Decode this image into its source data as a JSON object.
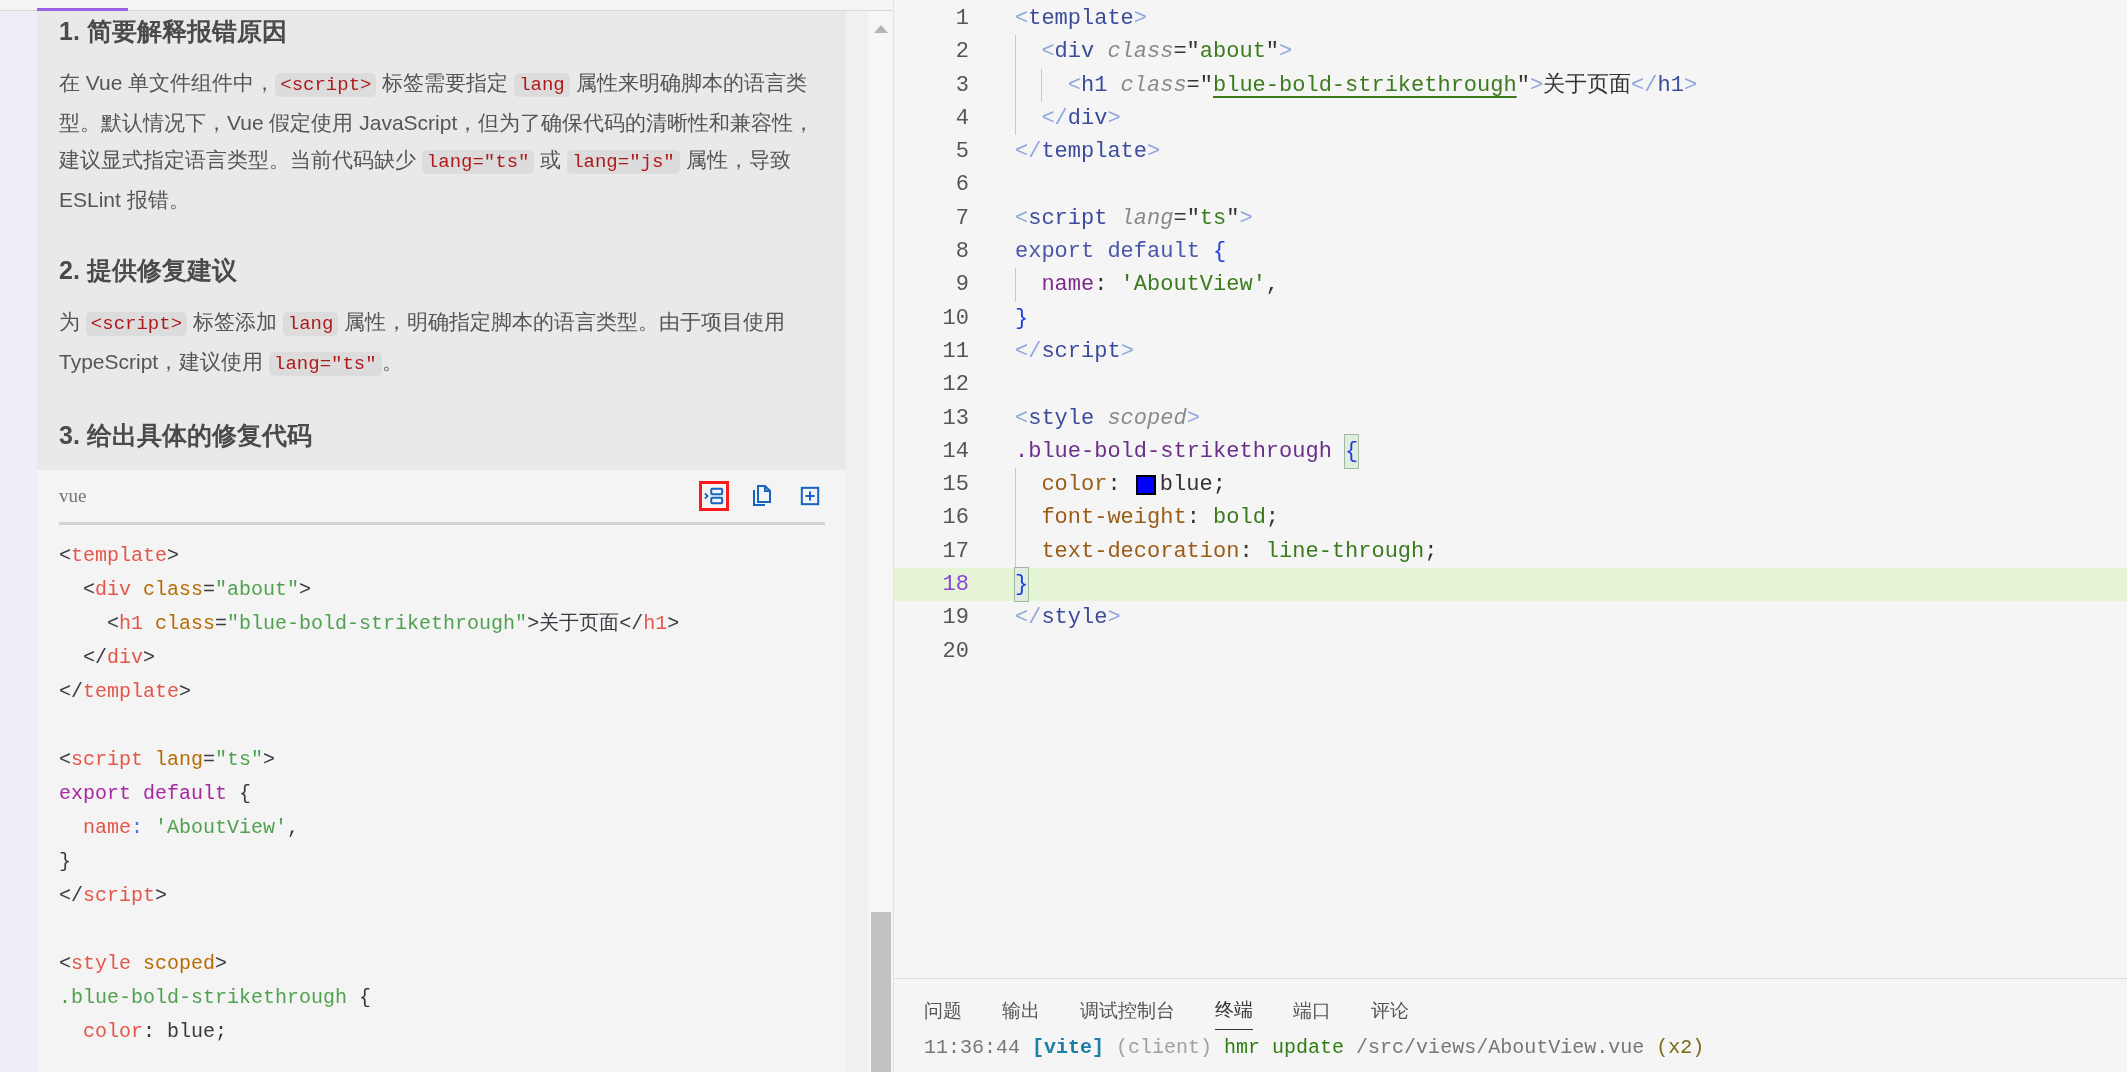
{
  "answer": {
    "sections": [
      {
        "heading": "1. 简要解释报错原因",
        "paragraph": [
          {
            "text": "在 Vue 单文件组件中，",
            "code": false
          },
          {
            "text": "<script>",
            "code": true
          },
          {
            "text": " 标签需要指定 ",
            "code": false
          },
          {
            "text": "lang",
            "code": true
          },
          {
            "text": " 属性来明确脚本的语言类型。默认情况下，Vue 假定使用 JavaScript，但为了确保代码的清晰性和兼容性，建议显式指定语言类型。当前代码缺少 ",
            "code": false
          },
          {
            "text": "lang=\"ts\"",
            "code": true
          },
          {
            "text": " 或 ",
            "code": false
          },
          {
            "text": "lang=\"js\"",
            "code": true
          },
          {
            "text": " 属性，导致 ESLint 报错。",
            "code": false
          }
        ]
      },
      {
        "heading": "2. 提供修复建议",
        "paragraph": [
          {
            "text": "为 ",
            "code": false
          },
          {
            "text": "<script>",
            "code": true
          },
          {
            "text": " 标签添加 ",
            "code": false
          },
          {
            "text": "lang",
            "code": true
          },
          {
            "text": " 属性，明确指定脚本的语言类型。由于项目使用 TypeScript，建议使用 ",
            "code": false
          },
          {
            "text": "lang=\"ts\"",
            "code": true
          },
          {
            "text": "。",
            "code": false
          }
        ]
      },
      {
        "heading": "3. 给出具体的修复代码"
      }
    ],
    "code_block": {
      "language": "vue",
      "toolbar": [
        {
          "kind": "insert",
          "highlighted": true
        },
        {
          "kind": "copy",
          "highlighted": false
        },
        {
          "kind": "expand",
          "highlighted": false
        }
      ],
      "lines": [
        {
          "kind": "code",
          "tokens": [
            {
              "kind": "punct",
              "text": "<"
            },
            {
              "kind": "tag",
              "text": "template"
            },
            {
              "kind": "punct",
              "text": ">"
            }
          ]
        },
        {
          "kind": "code",
          "tokens": [
            {
              "kind": "punct",
              "text": "  <"
            },
            {
              "kind": "tag",
              "text": "div"
            },
            {
              "kind": "attr",
              "text": " class"
            },
            {
              "kind": "punct",
              "text": "="
            },
            {
              "kind": "string",
              "text": "\"about\""
            },
            {
              "kind": "punct",
              "text": ">"
            }
          ]
        },
        {
          "kind": "code",
          "tokens": [
            {
              "kind": "punct",
              "text": "    <"
            },
            {
              "kind": "tag",
              "text": "h1"
            },
            {
              "kind": "attr",
              "text": " class"
            },
            {
              "kind": "punct",
              "text": "="
            },
            {
              "kind": "string",
              "text": "\"blue-bold-strikethrough\""
            },
            {
              "kind": "punct",
              "text": ">关于页面</"
            },
            {
              "kind": "tag",
              "text": "h1"
            },
            {
              "kind": "punct",
              "text": ">"
            }
          ]
        },
        {
          "kind": "code",
          "tokens": [
            {
              "kind": "punct",
              "text": "  </"
            },
            {
              "kind": "tag",
              "text": "div"
            },
            {
              "kind": "punct",
              "text": ">"
            }
          ]
        },
        {
          "kind": "code",
          "tokens": [
            {
              "kind": "punct",
              "text": "</"
            },
            {
              "kind": "tag",
              "text": "template"
            },
            {
              "kind": "punct",
              "text": ">"
            }
          ]
        },
        {
          "kind": "blank"
        },
        {
          "kind": "code",
          "tokens": [
            {
              "kind": "punct",
              "text": "<"
            },
            {
              "kind": "tag",
              "text": "script"
            },
            {
              "kind": "attr",
              "text": " lang"
            },
            {
              "kind": "punct",
              "text": "="
            },
            {
              "kind": "string",
              "text": "\"ts\""
            },
            {
              "kind": "punct",
              "text": ">"
            }
          ]
        },
        {
          "kind": "code",
          "tokens": [
            {
              "kind": "keyword",
              "text": "export default"
            },
            {
              "kind": "punct",
              "text": " {"
            }
          ]
        },
        {
          "kind": "code",
          "tokens": [
            {
              "kind": "prop",
              "text": "  name"
            },
            {
              "kind": "colon",
              "text": ":"
            },
            {
              "kind": "string",
              "text": " 'AboutView'"
            },
            {
              "kind": "punct",
              "text": ","
            }
          ]
        },
        {
          "kind": "code",
          "tokens": [
            {
              "kind": "punct",
              "text": "}"
            }
          ]
        },
        {
          "kind": "code",
          "tokens": [
            {
              "kind": "punct",
              "text": "</"
            },
            {
              "kind": "tag",
              "text": "script"
            },
            {
              "kind": "punct",
              "text": ">"
            }
          ]
        },
        {
          "kind": "blank"
        },
        {
          "kind": "code",
          "tokens": [
            {
              "kind": "punct",
              "text": "<"
            },
            {
              "kind": "tag",
              "text": "style"
            },
            {
              "kind": "attr",
              "text": " scoped"
            },
            {
              "kind": "punct",
              "text": ">"
            }
          ]
        },
        {
          "kind": "code",
          "tokens": [
            {
              "kind": "string",
              "text": ".blue-bold-strikethrough"
            },
            {
              "kind": "punct",
              "text": " {"
            }
          ]
        },
        {
          "kind": "code",
          "tokens": [
            {
              "kind": "prop",
              "text": "  color"
            },
            {
              "kind": "punct",
              "text": ": blue;"
            }
          ]
        }
      ]
    }
  },
  "editor": {
    "lines": [
      {
        "number": "1",
        "current": false,
        "tokens": [
          {
            "kind": "bracket",
            "text": "<"
          },
          {
            "kind": "tag",
            "text": "template"
          },
          {
            "kind": "bracket",
            "text": ">"
          }
        ]
      },
      {
        "number": "2",
        "current": false,
        "tokens": [
          {
            "kind": "bracket",
            "text": "  <"
          },
          {
            "kind": "tag",
            "text": "div "
          },
          {
            "kind": "attr",
            "text": "class"
          },
          {
            "kind": "plain",
            "text": "=\""
          },
          {
            "kind": "string",
            "text": "about"
          },
          {
            "kind": "plain",
            "text": "\""
          },
          {
            "kind": "bracket",
            "text": ">"
          }
        ]
      },
      {
        "number": "3",
        "current": false,
        "tokens": [
          {
            "kind": "bracket",
            "text": "    <"
          },
          {
            "kind": "tag",
            "text": "h1 "
          },
          {
            "kind": "attr",
            "text": "class"
          },
          {
            "kind": "plain",
            "text": "=\""
          },
          {
            "kind": "underlined-string",
            "text": "blue-bold-strikethrough"
          },
          {
            "kind": "plain",
            "text": "\""
          },
          {
            "kind": "bracket",
            "text": ">"
          },
          {
            "kind": "plain",
            "text": "关于页面"
          },
          {
            "kind": "bracket",
            "text": "</"
          },
          {
            "kind": "tag",
            "text": "h1"
          },
          {
            "kind": "bracket",
            "text": ">"
          }
        ]
      },
      {
        "number": "4",
        "current": false,
        "tokens": [
          {
            "kind": "bracket",
            "text": "  </"
          },
          {
            "kind": "tag",
            "text": "div"
          },
          {
            "kind": "bracket",
            "text": ">"
          }
        ]
      },
      {
        "number": "5",
        "current": false,
        "tokens": [
          {
            "kind": "bracket",
            "text": "</"
          },
          {
            "kind": "tag",
            "text": "template"
          },
          {
            "kind": "bracket",
            "text": ">"
          }
        ]
      },
      {
        "number": "6",
        "current": false
      },
      {
        "number": "7",
        "current": false,
        "tokens": [
          {
            "kind": "bracket",
            "text": "<"
          },
          {
            "kind": "tag",
            "text": "script "
          },
          {
            "kind": "attr",
            "text": "lang"
          },
          {
            "kind": "plain",
            "text": "=\""
          },
          {
            "kind": "string",
            "text": "ts"
          },
          {
            "kind": "plain",
            "text": "\""
          },
          {
            "kind": "bracket",
            "text": ">"
          }
        ]
      },
      {
        "number": "8",
        "current": false,
        "tokens": [
          {
            "kind": "keyword",
            "text": "export default "
          },
          {
            "kind": "brace",
            "text": "{"
          }
        ]
      },
      {
        "number": "9",
        "current": false,
        "tokens": [
          {
            "kind": "prop",
            "text": "  name"
          },
          {
            "kind": "plain",
            "text": ": "
          },
          {
            "kind": "string",
            "text": "'AboutView'"
          },
          {
            "kind": "plain",
            "text": ","
          }
        ]
      },
      {
        "number": "10",
        "current": false,
        "tokens": [
          {
            "kind": "brace",
            "text": "}"
          }
        ]
      },
      {
        "number": "11",
        "current": false,
        "tokens": [
          {
            "kind": "bracket",
            "text": "</"
          },
          {
            "kind": "tag",
            "text": "script"
          },
          {
            "kind": "bracket",
            "text": ">"
          }
        ]
      },
      {
        "number": "12",
        "current": false
      },
      {
        "number": "13",
        "current": false,
        "tokens": [
          {
            "kind": "bracket",
            "text": "<"
          },
          {
            "kind": "tag",
            "text": "style "
          },
          {
            "kind": "attr",
            "text": "scoped"
          },
          {
            "kind": "bracket",
            "text": ">"
          }
        ]
      },
      {
        "number": "14",
        "current": false,
        "tokens": [
          {
            "kind": "selector",
            "text": ".blue-bold-strikethrough "
          },
          {
            "kind": "matched-brace",
            "text": "{"
          }
        ]
      },
      {
        "number": "15",
        "current": false,
        "tokens": [
          {
            "kind": "css-prop",
            "text": "  color"
          },
          {
            "kind": "plain",
            "text": ": "
          },
          {
            "kind": "color-value",
            "text": "blue"
          },
          {
            "kind": "plain",
            "text": ";"
          }
        ]
      },
      {
        "number": "16",
        "current": false,
        "tokens": [
          {
            "kind": "css-prop",
            "text": "  font-weight"
          },
          {
            "kind": "plain",
            "text": ": "
          },
          {
            "kind": "css-value",
            "text": "bold"
          },
          {
            "kind": "plain",
            "text": ";"
          }
        ]
      },
      {
        "number": "17",
        "current": false,
        "tokens": [
          {
            "kind": "css-prop",
            "text": "  text-decoration"
          },
          {
            "kind": "plain",
            "text": ": "
          },
          {
            "kind": "css-value",
            "text": "line-through"
          },
          {
            "kind": "plain",
            "text": ";"
          }
        ]
      },
      {
        "number": "18",
        "current": true,
        "tokens": [
          {
            "kind": "matched-brace",
            "text": "}"
          }
        ]
      },
      {
        "number": "19",
        "current": false,
        "tokens": [
          {
            "kind": "bracket",
            "text": "</"
          },
          {
            "kind": "tag",
            "text": "style"
          },
          {
            "kind": "bracket",
            "text": ">"
          }
        ]
      },
      {
        "number": "20",
        "current": false
      }
    ]
  },
  "panel": {
    "tabs": [
      {
        "label": "问题",
        "selected": false
      },
      {
        "label": "输出",
        "selected": false
      },
      {
        "label": "调试控制台",
        "selected": false
      },
      {
        "label": "终端",
        "selected": true
      },
      {
        "label": "端口",
        "selected": false
      },
      {
        "label": "评论",
        "selected": false
      }
    ],
    "terminal_line": [
      {
        "kind": "time",
        "text": "11:36:44 "
      },
      {
        "kind": "tag",
        "text": "[vite]"
      },
      {
        "kind": "muted",
        "text": " (client)"
      },
      {
        "kind": "action",
        "text": " hmr update"
      },
      {
        "kind": "path",
        "text": " /src/views/AboutView.vue"
      },
      {
        "kind": "count",
        "text": " (x2)"
      }
    ]
  }
}
